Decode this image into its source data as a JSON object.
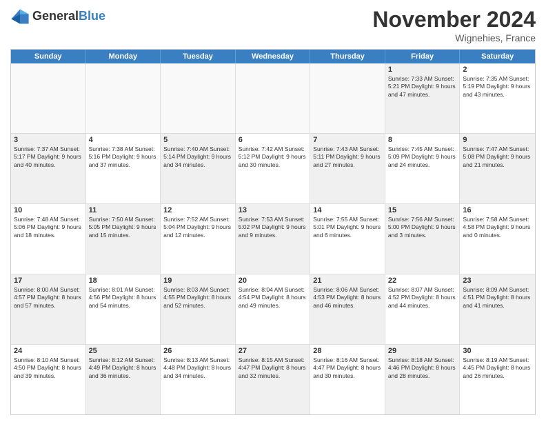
{
  "header": {
    "logo_general": "General",
    "logo_blue": "Blue",
    "month": "November 2024",
    "location": "Wignehies, France"
  },
  "weekdays": [
    "Sunday",
    "Monday",
    "Tuesday",
    "Wednesday",
    "Thursday",
    "Friday",
    "Saturday"
  ],
  "rows": [
    [
      {
        "day": "",
        "info": "",
        "empty": true
      },
      {
        "day": "",
        "info": "",
        "empty": true
      },
      {
        "day": "",
        "info": "",
        "empty": true
      },
      {
        "day": "",
        "info": "",
        "empty": true
      },
      {
        "day": "",
        "info": "",
        "empty": true
      },
      {
        "day": "1",
        "info": "Sunrise: 7:33 AM\nSunset: 5:21 PM\nDaylight: 9 hours and 47 minutes.",
        "shaded": true
      },
      {
        "day": "2",
        "info": "Sunrise: 7:35 AM\nSunset: 5:19 PM\nDaylight: 9 hours and 43 minutes.",
        "shaded": false
      }
    ],
    [
      {
        "day": "3",
        "info": "Sunrise: 7:37 AM\nSunset: 5:17 PM\nDaylight: 9 hours and 40 minutes.",
        "shaded": true
      },
      {
        "day": "4",
        "info": "Sunrise: 7:38 AM\nSunset: 5:16 PM\nDaylight: 9 hours and 37 minutes.",
        "shaded": false
      },
      {
        "day": "5",
        "info": "Sunrise: 7:40 AM\nSunset: 5:14 PM\nDaylight: 9 hours and 34 minutes.",
        "shaded": true
      },
      {
        "day": "6",
        "info": "Sunrise: 7:42 AM\nSunset: 5:12 PM\nDaylight: 9 hours and 30 minutes.",
        "shaded": false
      },
      {
        "day": "7",
        "info": "Sunrise: 7:43 AM\nSunset: 5:11 PM\nDaylight: 9 hours and 27 minutes.",
        "shaded": true
      },
      {
        "day": "8",
        "info": "Sunrise: 7:45 AM\nSunset: 5:09 PM\nDaylight: 9 hours and 24 minutes.",
        "shaded": false
      },
      {
        "day": "9",
        "info": "Sunrise: 7:47 AM\nSunset: 5:08 PM\nDaylight: 9 hours and 21 minutes.",
        "shaded": true
      }
    ],
    [
      {
        "day": "10",
        "info": "Sunrise: 7:48 AM\nSunset: 5:06 PM\nDaylight: 9 hours and 18 minutes.",
        "shaded": false
      },
      {
        "day": "11",
        "info": "Sunrise: 7:50 AM\nSunset: 5:05 PM\nDaylight: 9 hours and 15 minutes.",
        "shaded": true
      },
      {
        "day": "12",
        "info": "Sunrise: 7:52 AM\nSunset: 5:04 PM\nDaylight: 9 hours and 12 minutes.",
        "shaded": false
      },
      {
        "day": "13",
        "info": "Sunrise: 7:53 AM\nSunset: 5:02 PM\nDaylight: 9 hours and 9 minutes.",
        "shaded": true
      },
      {
        "day": "14",
        "info": "Sunrise: 7:55 AM\nSunset: 5:01 PM\nDaylight: 9 hours and 6 minutes.",
        "shaded": false
      },
      {
        "day": "15",
        "info": "Sunrise: 7:56 AM\nSunset: 5:00 PM\nDaylight: 9 hours and 3 minutes.",
        "shaded": true
      },
      {
        "day": "16",
        "info": "Sunrise: 7:58 AM\nSunset: 4:58 PM\nDaylight: 9 hours and 0 minutes.",
        "shaded": false
      }
    ],
    [
      {
        "day": "17",
        "info": "Sunrise: 8:00 AM\nSunset: 4:57 PM\nDaylight: 8 hours and 57 minutes.",
        "shaded": true
      },
      {
        "day": "18",
        "info": "Sunrise: 8:01 AM\nSunset: 4:56 PM\nDaylight: 8 hours and 54 minutes.",
        "shaded": false
      },
      {
        "day": "19",
        "info": "Sunrise: 8:03 AM\nSunset: 4:55 PM\nDaylight: 8 hours and 52 minutes.",
        "shaded": true
      },
      {
        "day": "20",
        "info": "Sunrise: 8:04 AM\nSunset: 4:54 PM\nDaylight: 8 hours and 49 minutes.",
        "shaded": false
      },
      {
        "day": "21",
        "info": "Sunrise: 8:06 AM\nSunset: 4:53 PM\nDaylight: 8 hours and 46 minutes.",
        "shaded": true
      },
      {
        "day": "22",
        "info": "Sunrise: 8:07 AM\nSunset: 4:52 PM\nDaylight: 8 hours and 44 minutes.",
        "shaded": false
      },
      {
        "day": "23",
        "info": "Sunrise: 8:09 AM\nSunset: 4:51 PM\nDaylight: 8 hours and 41 minutes.",
        "shaded": true
      }
    ],
    [
      {
        "day": "24",
        "info": "Sunrise: 8:10 AM\nSunset: 4:50 PM\nDaylight: 8 hours and 39 minutes.",
        "shaded": false
      },
      {
        "day": "25",
        "info": "Sunrise: 8:12 AM\nSunset: 4:49 PM\nDaylight: 8 hours and 36 minutes.",
        "shaded": true
      },
      {
        "day": "26",
        "info": "Sunrise: 8:13 AM\nSunset: 4:48 PM\nDaylight: 8 hours and 34 minutes.",
        "shaded": false
      },
      {
        "day": "27",
        "info": "Sunrise: 8:15 AM\nSunset: 4:47 PM\nDaylight: 8 hours and 32 minutes.",
        "shaded": true
      },
      {
        "day": "28",
        "info": "Sunrise: 8:16 AM\nSunset: 4:47 PM\nDaylight: 8 hours and 30 minutes.",
        "shaded": false
      },
      {
        "day": "29",
        "info": "Sunrise: 8:18 AM\nSunset: 4:46 PM\nDaylight: 8 hours and 28 minutes.",
        "shaded": true
      },
      {
        "day": "30",
        "info": "Sunrise: 8:19 AM\nSunset: 4:45 PM\nDaylight: 8 hours and 26 minutes.",
        "shaded": false
      }
    ]
  ]
}
